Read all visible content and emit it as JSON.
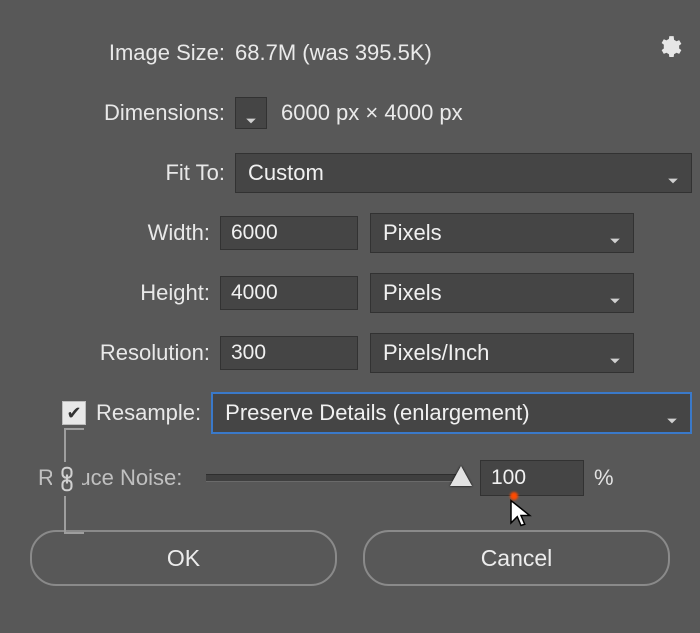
{
  "header": {
    "image_size_label": "Image Size:",
    "image_size_value": "68.7M (was 395.5K)"
  },
  "dimensions": {
    "label": "Dimensions:",
    "value": "6000 px  ×  4000 px"
  },
  "fit_to": {
    "label": "Fit To:",
    "value": "Custom"
  },
  "width": {
    "label": "Width:",
    "value": "6000",
    "unit": "Pixels"
  },
  "height": {
    "label": "Height:",
    "value": "4000",
    "unit": "Pixels"
  },
  "resolution": {
    "label": "Resolution:",
    "value": "300",
    "unit": "Pixels/Inch"
  },
  "resample": {
    "label": "Resample:",
    "checked": true,
    "method": "Preserve Details (enlargement)"
  },
  "reduce_noise": {
    "label": "Reduce Noise:",
    "value": "100",
    "suffix": "%"
  },
  "buttons": {
    "ok": "OK",
    "cancel": "Cancel"
  }
}
